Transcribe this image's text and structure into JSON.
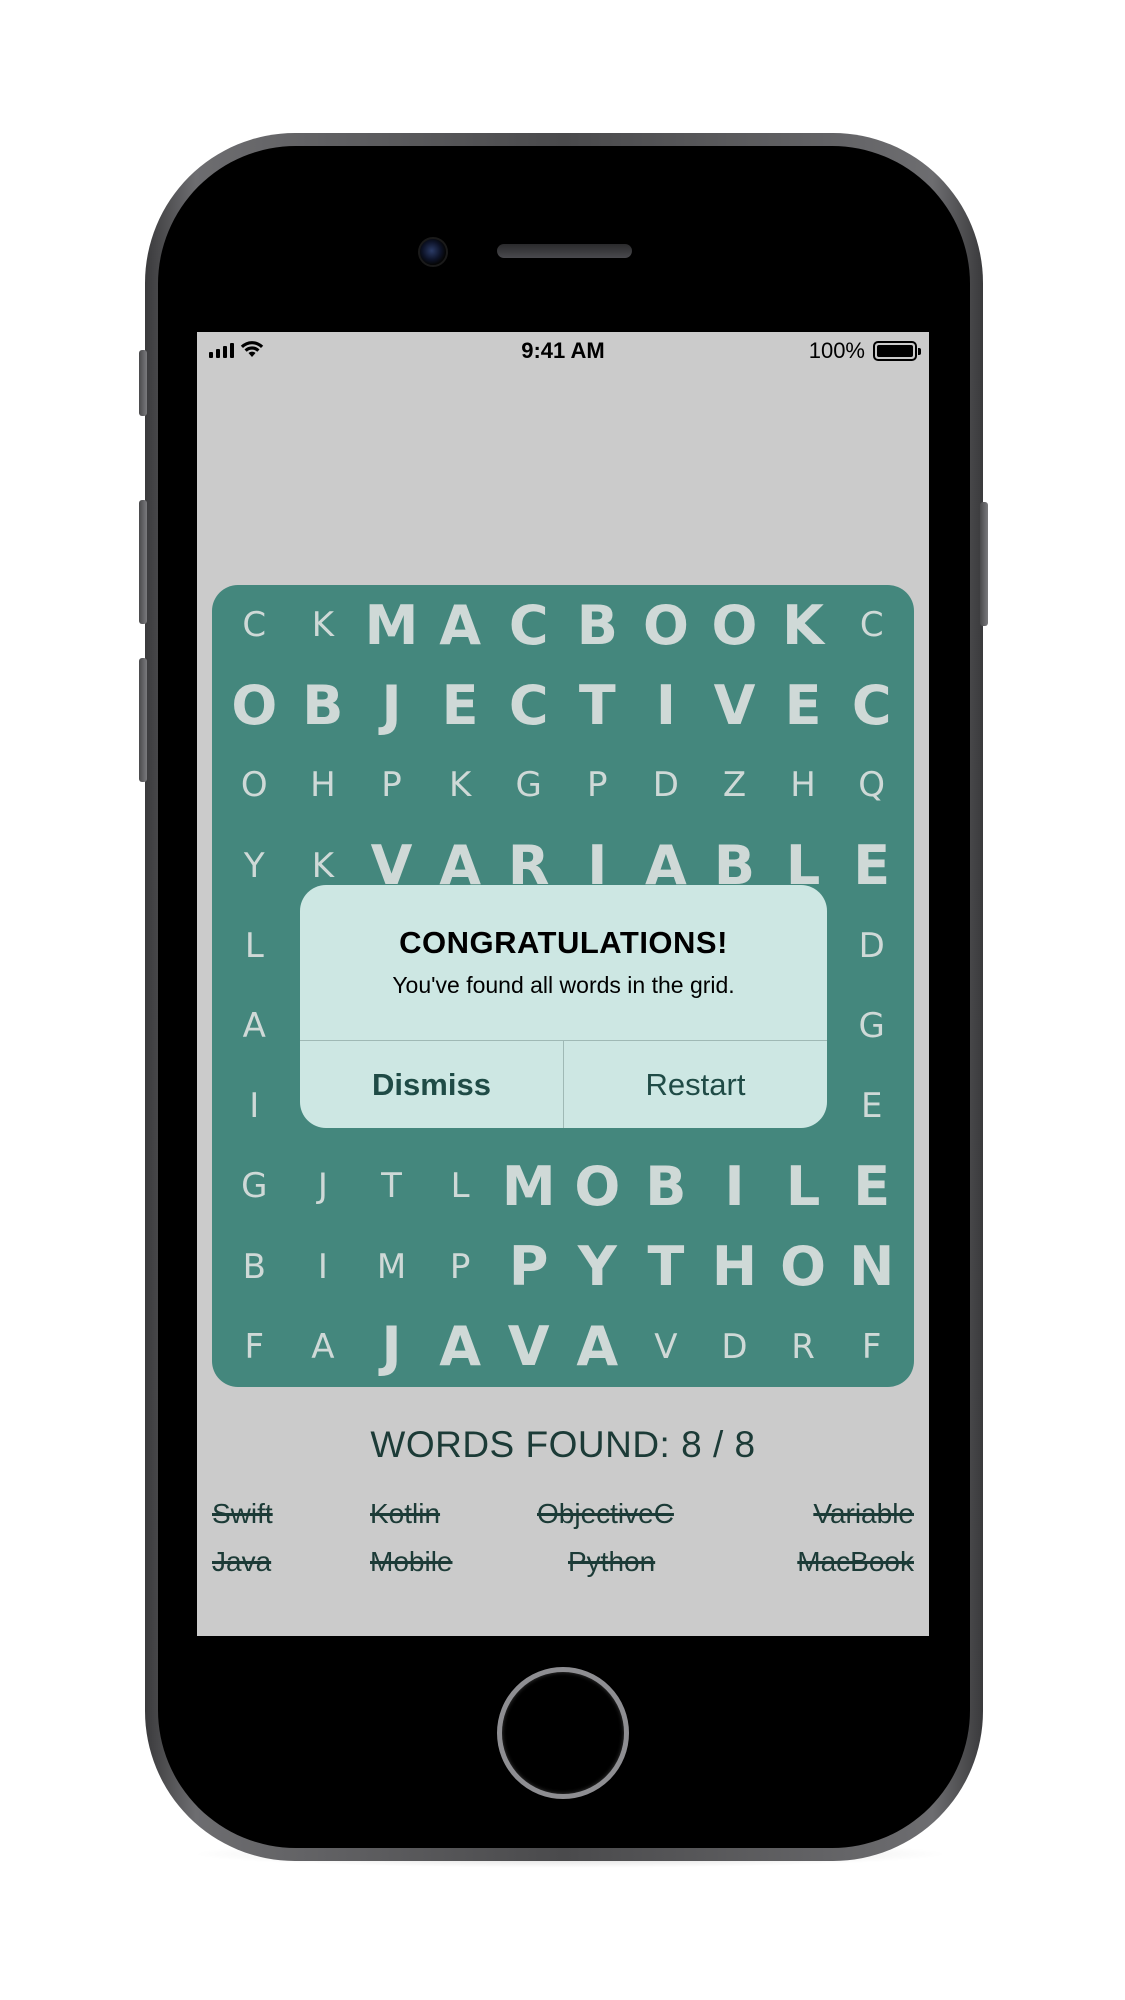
{
  "status_bar": {
    "time": "9:41 AM",
    "battery_text": "100%"
  },
  "grid": {
    "rows": [
      [
        {
          "l": "C",
          "f": false
        },
        {
          "l": "K",
          "f": false
        },
        {
          "l": "M",
          "f": true
        },
        {
          "l": "A",
          "f": true
        },
        {
          "l": "C",
          "f": true
        },
        {
          "l": "B",
          "f": true
        },
        {
          "l": "O",
          "f": true
        },
        {
          "l": "O",
          "f": true
        },
        {
          "l": "K",
          "f": true
        },
        {
          "l": "C",
          "f": false
        }
      ],
      [
        {
          "l": "O",
          "f": true
        },
        {
          "l": "B",
          "f": true
        },
        {
          "l": "J",
          "f": true
        },
        {
          "l": "E",
          "f": true
        },
        {
          "l": "C",
          "f": true
        },
        {
          "l": "T",
          "f": true
        },
        {
          "l": "I",
          "f": true
        },
        {
          "l": "V",
          "f": true
        },
        {
          "l": "E",
          "f": true
        },
        {
          "l": "C",
          "f": true
        }
      ],
      [
        {
          "l": "O",
          "f": false
        },
        {
          "l": "H",
          "f": false
        },
        {
          "l": "P",
          "f": false
        },
        {
          "l": "K",
          "f": false
        },
        {
          "l": "G",
          "f": false
        },
        {
          "l": "P",
          "f": false
        },
        {
          "l": "D",
          "f": false
        },
        {
          "l": "Z",
          "f": false
        },
        {
          "l": "H",
          "f": false
        },
        {
          "l": "Q",
          "f": false
        }
      ],
      [
        {
          "l": "Y",
          "f": false
        },
        {
          "l": "K",
          "f": false
        },
        {
          "l": "V",
          "f": true
        },
        {
          "l": "A",
          "f": true
        },
        {
          "l": "R",
          "f": true
        },
        {
          "l": "I",
          "f": true
        },
        {
          "l": "A",
          "f": true
        },
        {
          "l": "B",
          "f": true
        },
        {
          "l": "L",
          "f": true
        },
        {
          "l": "E",
          "f": true
        }
      ],
      [
        {
          "l": "L",
          "f": false
        },
        {
          "l": "",
          "f": false
        },
        {
          "l": "",
          "f": false
        },
        {
          "l": "",
          "f": false
        },
        {
          "l": "",
          "f": false
        },
        {
          "l": "",
          "f": false
        },
        {
          "l": "",
          "f": false
        },
        {
          "l": "",
          "f": false
        },
        {
          "l": "",
          "f": false
        },
        {
          "l": "D",
          "f": false
        }
      ],
      [
        {
          "l": "A",
          "f": false
        },
        {
          "l": "",
          "f": false
        },
        {
          "l": "",
          "f": false
        },
        {
          "l": "",
          "f": false
        },
        {
          "l": "",
          "f": false
        },
        {
          "l": "",
          "f": false
        },
        {
          "l": "",
          "f": false
        },
        {
          "l": "",
          "f": false
        },
        {
          "l": "",
          "f": false
        },
        {
          "l": "G",
          "f": false
        }
      ],
      [
        {
          "l": "I",
          "f": false
        },
        {
          "l": "",
          "f": false
        },
        {
          "l": "",
          "f": false
        },
        {
          "l": "",
          "f": false
        },
        {
          "l": "",
          "f": false
        },
        {
          "l": "",
          "f": false
        },
        {
          "l": "",
          "f": false
        },
        {
          "l": "",
          "f": false
        },
        {
          "l": "",
          "f": false
        },
        {
          "l": "E",
          "f": false
        }
      ],
      [
        {
          "l": "G",
          "f": false
        },
        {
          "l": "J",
          "f": false
        },
        {
          "l": "T",
          "f": false
        },
        {
          "l": "L",
          "f": false
        },
        {
          "l": "M",
          "f": true
        },
        {
          "l": "O",
          "f": true
        },
        {
          "l": "B",
          "f": true
        },
        {
          "l": "I",
          "f": true
        },
        {
          "l": "L",
          "f": true
        },
        {
          "l": "E",
          "f": true
        }
      ],
      [
        {
          "l": "B",
          "f": false
        },
        {
          "l": "I",
          "f": false
        },
        {
          "l": "M",
          "f": false
        },
        {
          "l": "P",
          "f": false
        },
        {
          "l": "P",
          "f": true
        },
        {
          "l": "Y",
          "f": true
        },
        {
          "l": "T",
          "f": true
        },
        {
          "l": "H",
          "f": true
        },
        {
          "l": "O",
          "f": true
        },
        {
          "l": "N",
          "f": true
        }
      ],
      [
        {
          "l": "F",
          "f": false
        },
        {
          "l": "A",
          "f": false
        },
        {
          "l": "J",
          "f": true
        },
        {
          "l": "A",
          "f": true
        },
        {
          "l": "V",
          "f": true
        },
        {
          "l": "A",
          "f": true
        },
        {
          "l": "V",
          "f": false
        },
        {
          "l": "D",
          "f": false
        },
        {
          "l": "R",
          "f": false
        },
        {
          "l": "F",
          "f": false
        }
      ]
    ]
  },
  "alert": {
    "title": "CONGRATULATIONS!",
    "message": "You've found all words in the grid.",
    "dismiss_label": "Dismiss",
    "restart_label": "Restart"
  },
  "words_found": {
    "label": "WORDS FOUND: 8 / 8"
  },
  "words": [
    "Swift",
    "Kotlin",
    "ObjectiveC",
    "Variable",
    "Java",
    "Mobile",
    "Python",
    "MacBook"
  ],
  "colors": {
    "grid_background": "#44877d",
    "screen_background": "#cbcbcb",
    "alert_background": "#cde7e3",
    "text_dark": "#1c3b37"
  }
}
